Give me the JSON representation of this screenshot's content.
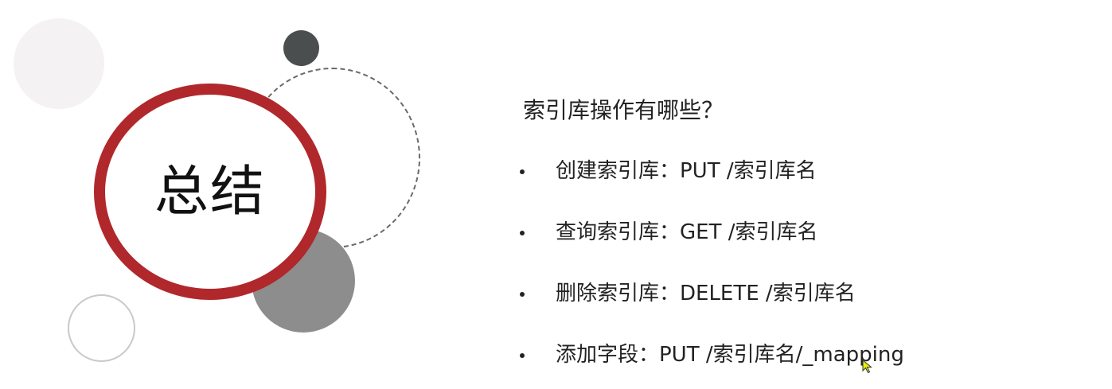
{
  "slide": {
    "title": "总结",
    "question": "索引库操作有哪些？",
    "bullets": [
      "创建索引库：PUT /索引库名",
      "查询索引库：GET /索引库名",
      "删除索引库：DELETE /索引库名",
      "添加字段：PUT /索引库名/_mapping"
    ],
    "colors": {
      "accent_red": "#b0282b",
      "dark_gray": "#4b4e4f",
      "mid_gray": "#8d8d8d",
      "light_gray": "#f4f2f2"
    },
    "cursor_icon": "mouse-pointer-icon"
  }
}
